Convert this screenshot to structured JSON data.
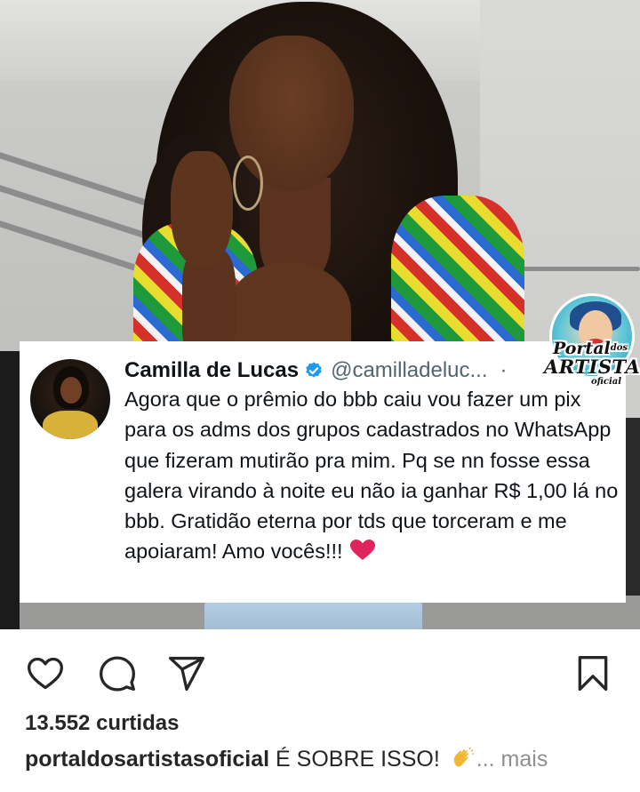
{
  "tweet": {
    "name": "Camilla de Lucas",
    "handle": "@camilladeluc...",
    "separator": "·",
    "text": "Agora que o prêmio do bbb caiu vou fazer um pix para os adms dos grupos cadastrados no WhatsApp que fizeram mutirão pra mim. Pq se nn fosse essa galera virando à noite eu não ia ganhar R$ 1,00 lá no bbb. Gratidão eterna por tds que torceram e me apoiaram! Amo vocês!!!",
    "emoji_icon": "red-heart-icon"
  },
  "watermark": {
    "line1": "Portal",
    "line1_small": "dos",
    "line2": "ARTISTAS",
    "line3": "oficial"
  },
  "post": {
    "likes": "13.552 curtidas",
    "username": "portaldosartistasoficial",
    "caption": " É SOBRE ISSO! ",
    "caption_emoji_icon": "clapping-hand-icon",
    "more": "... mais"
  },
  "icons": {
    "like": "heart-outline-icon",
    "comment": "comment-bubble-icon",
    "share": "paper-plane-icon",
    "save": "bookmark-icon"
  },
  "colors": {
    "verified": "#1d9bf0",
    "heart": "#e0245e",
    "text": "#262626",
    "muted": "#8e8e8e"
  }
}
